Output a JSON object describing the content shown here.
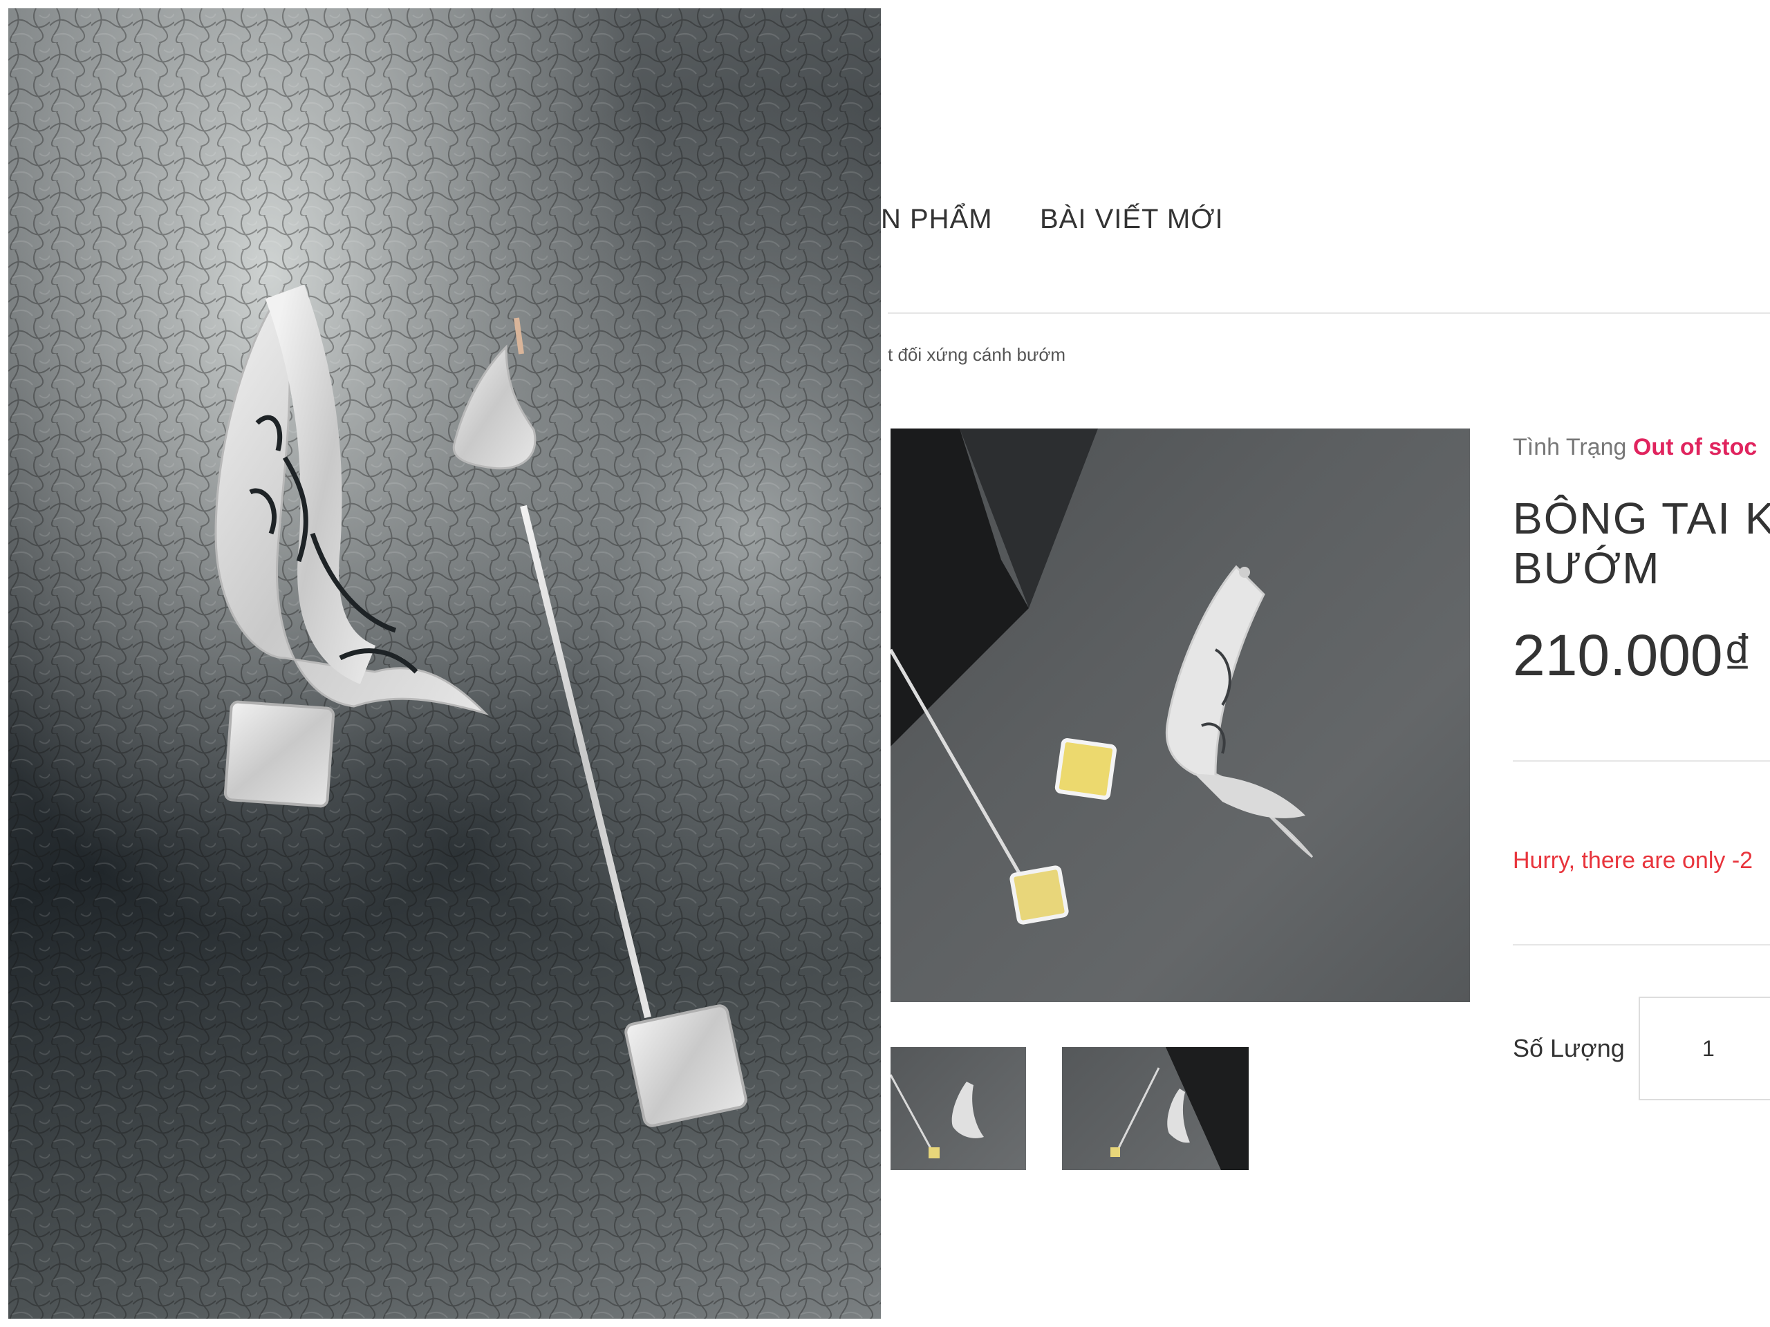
{
  "nav": {
    "products_label": "N PHẨM",
    "posts_label": "BÀI VIẾT MỚI"
  },
  "breadcrumb": {
    "text": "t đối xứng cánh bướm"
  },
  "product": {
    "status_label": "Tình Trạng",
    "status_value": "Out of stoc",
    "title_line1": "BÔNG TAI K",
    "title_line2": "BƯỚM",
    "price": "210.000₫",
    "stock_warning": "Hurry, there are only -2",
    "quantity_label": "Số Lượng",
    "quantity_value": "1"
  },
  "colors": {
    "accent_status": "#e0245e",
    "warning": "#e8343c"
  },
  "icons": {
    "left_photo": "butterfly-earrings-photo",
    "main_image": "butterfly-earrings-product-image"
  }
}
